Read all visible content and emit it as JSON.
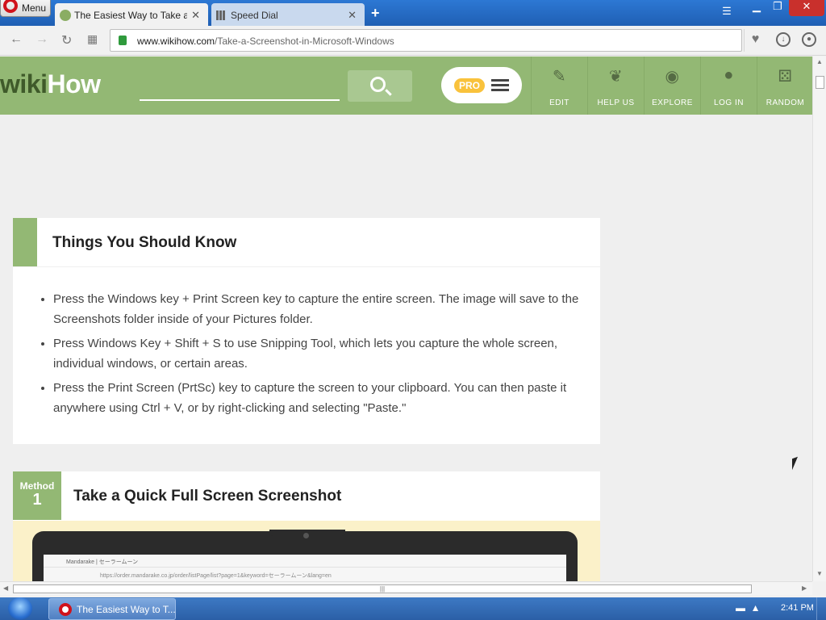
{
  "browser": {
    "menu_label": "Menu",
    "tabs": [
      {
        "label": "The Easiest Way to Take a S"
      },
      {
        "label": "Speed Dial"
      }
    ],
    "new_tab_symbol": "+",
    "url_domain": "www.wikihow.com",
    "url_path": "/Take-a-Screenshot-in-Microsoft-Windows"
  },
  "site": {
    "logo_wiki": "wiki",
    "logo_how": "How",
    "pro_badge": "PRO",
    "nav": [
      {
        "label": "EDIT",
        "icon": "pencil-icon"
      },
      {
        "label": "HELP US",
        "icon": "sprout-icon"
      },
      {
        "label": "EXPLORE",
        "icon": "compass-icon"
      },
      {
        "label": "LOG IN",
        "icon": "user-icon"
      },
      {
        "label": "RANDOM",
        "icon": "dice-icon"
      }
    ]
  },
  "article": {
    "things_title": "Things You Should Know",
    "bullets": [
      "Press the Windows key + Print Screen key to capture the entire screen. The image will save to the Screenshots folder inside of your Pictures folder.",
      "Press Windows Key + Shift + S to use Snipping Tool, which lets you capture the whole screen, individual windows, or certain areas.",
      "Press the Print Screen (PrtSc) key to capture the screen to your clipboard. You can then paste it anywhere using Ctrl + V, or by right-clicking and selecting \"Paste.\""
    ],
    "method_label": "Method",
    "method_number": "1",
    "method_title": "Take a Quick Full Screen Screenshot",
    "illustration_tab": "Mandarake | セーラームーン",
    "illustration_url": "https://order.mandarake.co.jp/order/listPage/list?page=1&keyword=セーラームーン&lang=en"
  },
  "taskbar": {
    "window_button": "The Easiest Way to T...",
    "clock": "2:41 PM"
  },
  "colors": {
    "wikihow_green": "#93b874",
    "titlebar_blue": "#2d78d4",
    "close_red": "#c9302c"
  }
}
